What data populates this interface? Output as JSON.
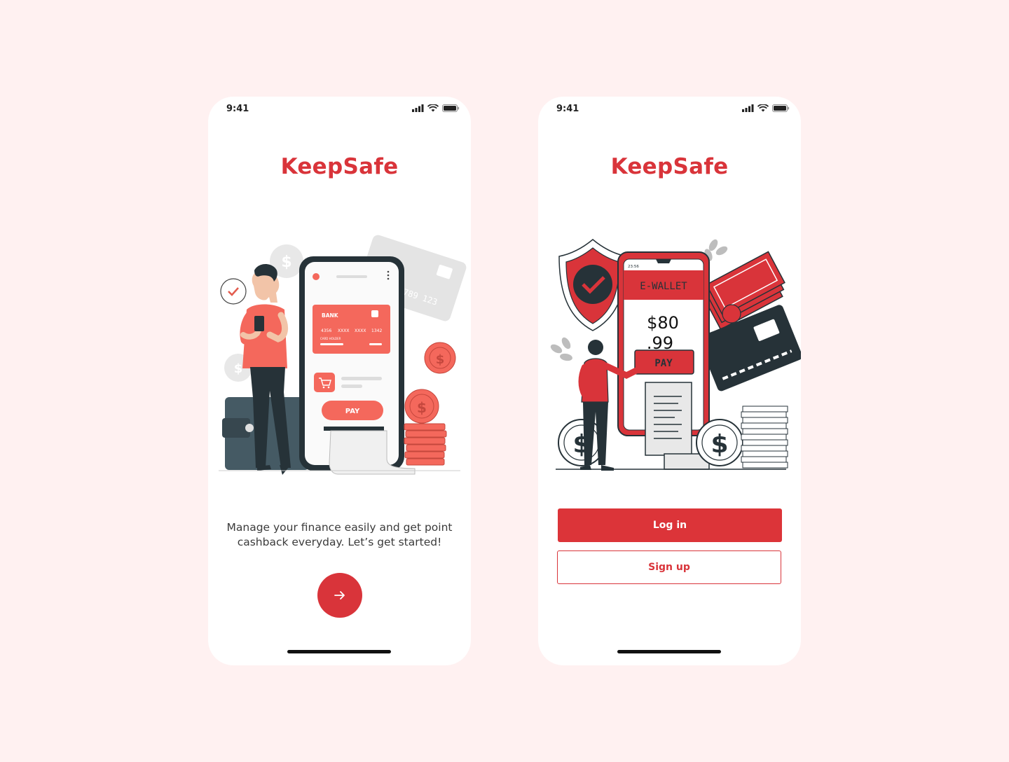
{
  "colors": {
    "page_bg": "#fff1f1",
    "brand_red": "#d9343a",
    "coral": "#f4685c",
    "dark": "#263238"
  },
  "screens": [
    {
      "status": {
        "time": "9:41"
      },
      "brand": "KeepSafe",
      "illustration": {
        "card_label": "BANK",
        "card_numbers": [
          "4356",
          "XXXX",
          "XXXX",
          "1342"
        ],
        "card_holder": "CARD HOLDER",
        "pay_label": "PAY",
        "back_card_number": "789 123"
      },
      "tagline": "Manage your finance easily and get point cashback everyday. Let’s get started!",
      "next_icon": "arrow-right-icon"
    },
    {
      "status": {
        "time": "9:41"
      },
      "brand": "KeepSafe",
      "illustration": {
        "phone_time": "23:56",
        "wallet_title": "E-WALLET",
        "amount_line1": "$80",
        "amount_line2": ".99",
        "pay_label": "PAY"
      },
      "login_label": "Log in",
      "signup_label": "Sign up"
    }
  ]
}
